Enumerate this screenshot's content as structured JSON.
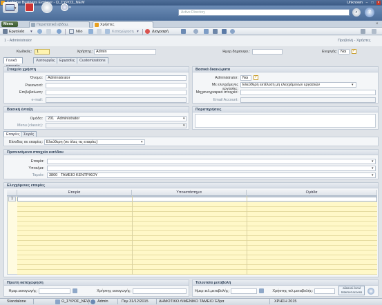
{
  "window": {
    "title": "SoftOne Business Explorer - Ω_ΣΥΡΟΣ_NEW",
    "user_label": "Unknown",
    "min": "–",
    "max": "□",
    "close": "×"
  },
  "ribbon": {
    "search_placeholder": "Active Directory"
  },
  "tabs": {
    "menu_label": "Menu",
    "tab1": "Περιστατικά εβδομ.",
    "tab2": "Χρήστες",
    "close": "×"
  },
  "toolbar": {
    "tools_label": "Εργαλεία",
    "new_label": "Νέο",
    "save_label": "Καταχώρηση",
    "delete_label": "Διαγραφή"
  },
  "header": {
    "breadcrumb": "1 - Administrator",
    "view_title": "Προβολή - Χρήστες",
    "code_label": "Κωδικός:",
    "code_value": "1",
    "user_label": "Χρήστης:",
    "user_value": "Admin",
    "created_label": "Ημερ.δημιουργ.:",
    "created_value": "",
    "active_label": "Ενεργός:",
    "active_value": "Ναι"
  },
  "subtabs": [
    "Γενικά στοιχεία",
    "Λειτουργίες",
    "Εργασίες",
    "Customizations"
  ],
  "user_panel": {
    "title": "Στοιχεία χρήστη",
    "name_label": "Όνομα:",
    "name_value": "Administrator",
    "password_label": "Password:",
    "confirm_label": "Επιβεβαίωση:",
    "email_label": "e-mail:"
  },
  "basic_panel": {
    "title": "Βασικά δικαιώματα",
    "admin_label": "Administrator:",
    "admin_value": "Ναι",
    "jobs_label": "Με ελεγχόμενες εργασίες:",
    "jobs_value": "Ελεύθερη εκτέλεση μη ελεγχόμενων εργασιών",
    "mech_label": "Μηχανογραφικό στοιχείο:",
    "email_account_label": "Email Account:"
  },
  "group_panel": {
    "title": "Βασική ένταξη",
    "group_label": "Ομάδα:",
    "group_code": "201",
    "group_value": "Administrator",
    "menu_label": "Menu (classic):"
  },
  "notes_panel": {
    "title": "Παρατηρήσεις"
  },
  "company_tabs": [
    "Εταιρίες",
    "Σειρές"
  ],
  "access": {
    "label": "Είσοδος σε εταιρίες:",
    "value": "Ελεύθερη (σε όλες τις εταιρίες)"
  },
  "default_panel": {
    "title": "Προτεινόμενα στοιχεία εισόδου",
    "company_label": "Εταιρία:",
    "branch_label": "Υποκ/μα:",
    "cash_label": "Ταμείο:",
    "cash_code": "3800",
    "cash_value": "ΤΑΜΕΙΟ ΚΕΝΤΡΙΚΟΥ"
  },
  "grid_panel": {
    "title": "Ελεγχόμενες εταιρίες",
    "columns": [
      "Εταιρία",
      "Υποκατάστημα",
      "Ομάδα"
    ],
    "row_marker": "1"
  },
  "created_panel": {
    "title": "Πρώτη καταχώρηση",
    "date_label": "Ημερ.εισαγωγής:",
    "user_label": "Χρήστης εισαγωγής:"
  },
  "modified_panel": {
    "title": "Τελευταία μεταβολή",
    "date_label": "Ημερ.τελ.μεταβολής:",
    "user_label": "Χρήστης τελ.μεταβολής:",
    "badge_line1": "aliasoni.local",
    "badge_line2": "Internet access"
  },
  "status": {
    "mode": "Standalone",
    "db": "Ω_ΣΥΡΟΣ_NEW",
    "user": "Admin",
    "date": "Πεμ 31/12/2015",
    "company": "ΔΗΜΟΤΙΚΟ ΛΙΜΕΝΙΚΟ ΤΑΜΕΙΟ  Έδρα",
    "period": "ΧΡΗΣΗ 2015"
  }
}
